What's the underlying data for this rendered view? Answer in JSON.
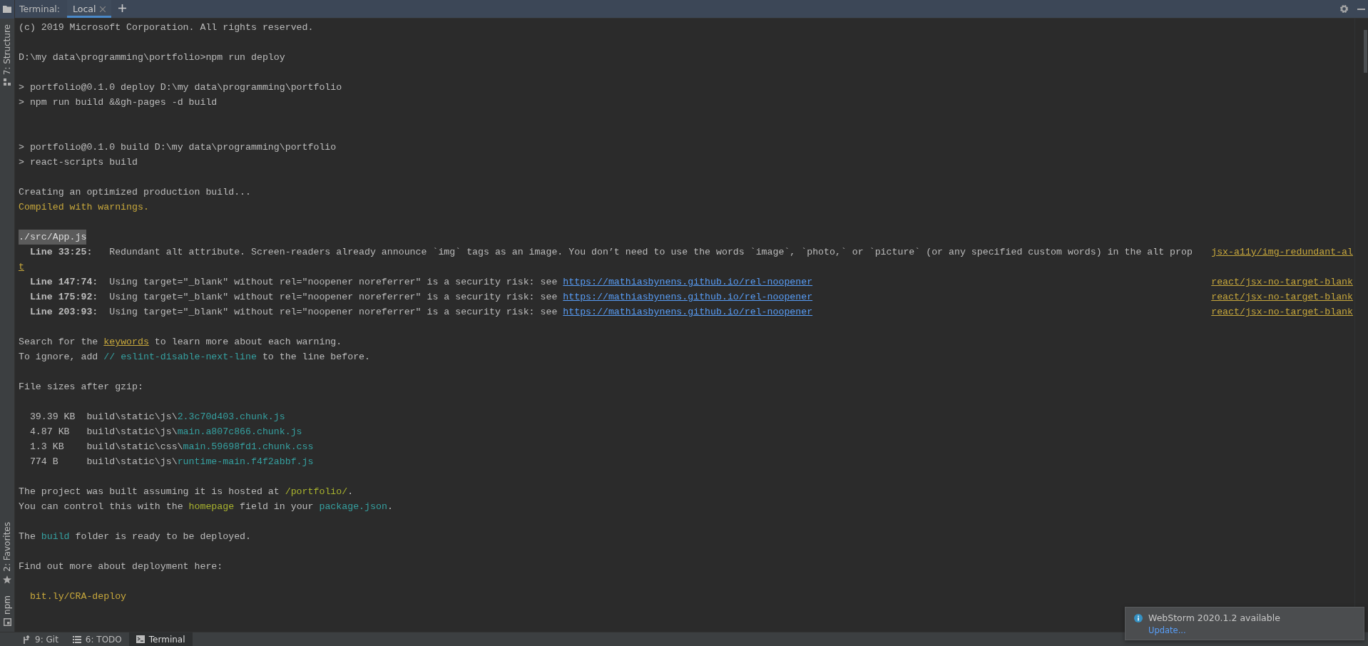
{
  "sidebar": {
    "top_tools": [
      {
        "label": "7: Structure",
        "kind": "structure"
      }
    ],
    "bottom_tools": [
      {
        "label": "2: Favorites",
        "kind": "favorites"
      },
      {
        "label": "npm",
        "kind": "npm"
      }
    ]
  },
  "toolbar": {
    "label": "Terminal:",
    "tabs": [
      {
        "label": "Local",
        "selected": true
      }
    ]
  },
  "terminal": {
    "lines": [
      {
        "kind": "text",
        "segments": [
          {
            "text": "(c) 2019 Microsoft Corporation. All rights reserved.",
            "kind": "plain"
          }
        ]
      },
      {
        "kind": "blank"
      },
      {
        "kind": "text",
        "segments": [
          {
            "text": "D:\\my data\\programming\\portfolio>npm run deploy",
            "kind": "plain"
          }
        ]
      },
      {
        "kind": "blank"
      },
      {
        "kind": "text",
        "segments": [
          {
            "text": "> portfolio@0.1.0 deploy D:\\my data\\programming\\portfolio",
            "kind": "plain"
          }
        ]
      },
      {
        "kind": "text",
        "segments": [
          {
            "text": "> npm run build &&gh-pages -d build",
            "kind": "plain"
          }
        ]
      },
      {
        "kind": "blank"
      },
      {
        "kind": "blank"
      },
      {
        "kind": "text",
        "segments": [
          {
            "text": "> portfolio@0.1.0 build D:\\my data\\programming\\portfolio",
            "kind": "plain"
          }
        ]
      },
      {
        "kind": "text",
        "segments": [
          {
            "text": "> react-scripts build",
            "kind": "plain"
          }
        ]
      },
      {
        "kind": "blank"
      },
      {
        "kind": "text",
        "segments": [
          {
            "text": "Creating an optimized production build...",
            "kind": "plain"
          }
        ]
      },
      {
        "kind": "text",
        "segments": [
          {
            "text": "Compiled with warnings.",
            "kind": "warning"
          }
        ]
      },
      {
        "kind": "blank"
      },
      {
        "kind": "highlight",
        "text": "./src/App.js"
      },
      {
        "kind": "warning",
        "label": "Line 33:25:",
        "segments": [
          {
            "text": "Redundant alt attribute. Screen-readers already announce `img` tags as an image. You don’t need to use the words `image`, `photo,` or `picture` (or any specified custom words) in the alt prop",
            "kind": "plain"
          }
        ],
        "rule": "jsx-a11y/img-redundant-al"
      },
      {
        "kind": "wrap",
        "text": "t"
      },
      {
        "kind": "warning",
        "label": "Line 147:74:",
        "segments": [
          {
            "text": "Using target=\"_blank\" without rel=\"noopener noreferrer\" is a security risk: see ",
            "kind": "plain"
          },
          {
            "text": "https://mathiasbynens.github.io/rel-noopener",
            "kind": "url"
          }
        ],
        "rule": "react/jsx-no-target-blank"
      },
      {
        "kind": "warning",
        "label": "Line 175:92:",
        "segments": [
          {
            "text": "Using target=\"_blank\" without rel=\"noopener noreferrer\" is a security risk: see ",
            "kind": "plain"
          },
          {
            "text": "https://mathiasbynens.github.io/rel-noopener",
            "kind": "url"
          }
        ],
        "rule": "react/jsx-no-target-blank"
      },
      {
        "kind": "warning",
        "label": "Line 203:93:",
        "segments": [
          {
            "text": "Using target=\"_blank\" without rel=\"noopener noreferrer\" is a security risk: see ",
            "kind": "plain"
          },
          {
            "text": "https://mathiasbynens.github.io/rel-noopener",
            "kind": "url"
          }
        ],
        "rule": "react/jsx-no-target-blank"
      },
      {
        "kind": "blank"
      },
      {
        "kind": "text",
        "segments": [
          {
            "text": "Search for the ",
            "kind": "plain"
          },
          {
            "text": "keywords",
            "kind": "link"
          },
          {
            "text": " to learn more about each warning.",
            "kind": "plain"
          }
        ]
      },
      {
        "kind": "text",
        "segments": [
          {
            "text": "To ignore, add ",
            "kind": "plain"
          },
          {
            "text": "// eslint-disable-next-line",
            "kind": "code"
          },
          {
            "text": " to the line before.",
            "kind": "plain"
          }
        ]
      },
      {
        "kind": "blank"
      },
      {
        "kind": "text",
        "segments": [
          {
            "text": "File sizes after gzip:",
            "kind": "plain"
          }
        ]
      },
      {
        "kind": "blank"
      },
      {
        "kind": "file",
        "size": "39.39 KB",
        "segments": [
          {
            "text": "build\\static\\js\\",
            "kind": "plain"
          },
          {
            "text": "2.3c70d403.chunk.js",
            "kind": "code"
          }
        ]
      },
      {
        "kind": "file",
        "size": "4.87 KB",
        "segments": [
          {
            "text": "build\\static\\js\\",
            "kind": "plain"
          },
          {
            "text": "main.a807c866.chunk.js",
            "kind": "code"
          }
        ]
      },
      {
        "kind": "file",
        "size": "1.3 KB",
        "segments": [
          {
            "text": "build\\static\\css\\",
            "kind": "plain"
          },
          {
            "text": "main.59698fd1.chunk.css",
            "kind": "code"
          }
        ]
      },
      {
        "kind": "file",
        "size": "774 B",
        "segments": [
          {
            "text": "build\\static\\js\\",
            "kind": "plain"
          },
          {
            "text": "runtime-main.f4f2abbf.js",
            "kind": "code"
          }
        ]
      },
      {
        "kind": "blank"
      },
      {
        "kind": "text",
        "segments": [
          {
            "text": "The project was built assuming it is hosted at ",
            "kind": "plain"
          },
          {
            "text": "/portfolio/",
            "kind": "value"
          },
          {
            "text": ".",
            "kind": "plain"
          }
        ]
      },
      {
        "kind": "text",
        "segments": [
          {
            "text": "You can control this with the ",
            "kind": "plain"
          },
          {
            "text": "homepage",
            "kind": "value"
          },
          {
            "text": " field in your ",
            "kind": "plain"
          },
          {
            "text": "package.json",
            "kind": "code"
          },
          {
            "text": ".",
            "kind": "plain"
          }
        ]
      },
      {
        "kind": "blank"
      },
      {
        "kind": "text",
        "segments": [
          {
            "text": "The ",
            "kind": "plain"
          },
          {
            "text": "build",
            "kind": "code"
          },
          {
            "text": " folder is ready to be deployed.",
            "kind": "plain"
          }
        ]
      },
      {
        "kind": "blank"
      },
      {
        "kind": "text",
        "segments": [
          {
            "text": "Find out more about deployment here:",
            "kind": "plain"
          }
        ]
      },
      {
        "kind": "blank"
      },
      {
        "kind": "text",
        "segments": [
          {
            "text": "  bit.ly/CRA-deploy",
            "kind": "warning"
          }
        ]
      }
    ]
  },
  "status_bar": {
    "items": [
      {
        "label": "9: Git",
        "kind": "git",
        "selected": false
      },
      {
        "label": "6: TODO",
        "kind": "todo",
        "selected": false
      },
      {
        "label": "Terminal",
        "kind": "terminal",
        "selected": true
      }
    ]
  },
  "notification": {
    "title": "WebStorm 2020.1.2 available",
    "action": "Update..."
  }
}
